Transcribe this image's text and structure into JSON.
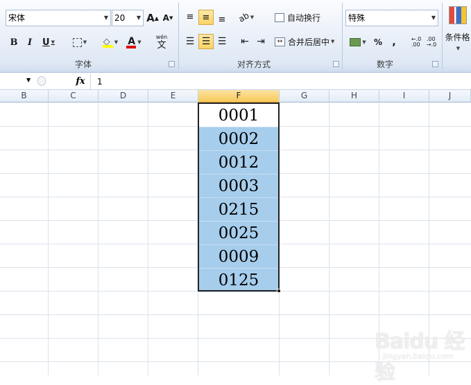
{
  "font_group": {
    "font_name": "宋体",
    "font_size": "20",
    "bold_label": "B",
    "italic_label": "I",
    "underline_label": "U",
    "grow_label": "A",
    "shrink_label": "A",
    "font_color_label": "A",
    "phonetic_label": "wén",
    "phonetic_char": "文",
    "group_label": "字体"
  },
  "alignment_group": {
    "wrap_text_label": "自动换行",
    "merge_center_label": "合并后居中",
    "group_label": "对齐方式"
  },
  "number_group": {
    "format_value": "特殊",
    "percent_label": "%",
    "comma_label": ",",
    "increase_decimal_label": ".0\n.00",
    "decrease_decimal_label": ".00",
    "group_label": "数字"
  },
  "styles_group": {
    "conditional_format_label": "条件格"
  },
  "formula_bar": {
    "fx_label": "fx",
    "value": "1"
  },
  "columns": [
    "B",
    "C",
    "D",
    "E",
    "F",
    "G",
    "H",
    "I",
    "J"
  ],
  "selected_column": "F",
  "cells": [
    "0001",
    "0002",
    "0012",
    "0003",
    "0215",
    "0025",
    "0009",
    "0125"
  ],
  "watermark": {
    "text": "Baidu 经验",
    "url": "jingyan.baidu.com"
  },
  "colors": {
    "selection_fill": "#a6cdec",
    "ribbon_bg": "#dde7f4",
    "active_button": "#fbd463"
  }
}
